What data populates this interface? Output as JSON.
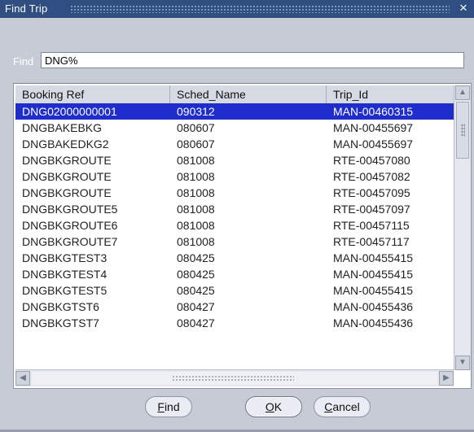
{
  "window": {
    "title": "Find Trip",
    "close_glyph": "×",
    "title_bg": "#2f4f82"
  },
  "search": {
    "label": "Find",
    "value": "DNG%"
  },
  "table": {
    "columns": [
      "Booking Ref",
      "Sched_Name",
      "Trip_Id"
    ],
    "rows": [
      [
        "DNG02000000001",
        "090312",
        "MAN-00460315"
      ],
      [
        "DNGBAKEBKG",
        "080607",
        "MAN-00455697"
      ],
      [
        "DNGBAKEDKG2",
        "080607",
        "MAN-00455697"
      ],
      [
        "DNGBKGROUTE",
        "081008",
        "RTE-00457080"
      ],
      [
        "DNGBKGROUTE",
        "081008",
        "RTE-00457082"
      ],
      [
        "DNGBKGROUTE",
        "081008",
        "RTE-00457095"
      ],
      [
        "DNGBKGROUTE5",
        "081008",
        "RTE-00457097"
      ],
      [
        "DNGBKGROUTE6",
        "081008",
        "RTE-00457115"
      ],
      [
        "DNGBKGROUTE7",
        "081008",
        "RTE-00457117"
      ],
      [
        "DNGBKGTEST3",
        "080425",
        "MAN-00455415"
      ],
      [
        "DNGBKGTEST4",
        "080425",
        "MAN-00455415"
      ],
      [
        "DNGBKGTEST5",
        "080425",
        "MAN-00455415"
      ],
      [
        "DNGBKGTST6",
        "080427",
        "MAN-00455436"
      ],
      [
        "DNGBKGTST7",
        "080427",
        "MAN-00455436"
      ]
    ],
    "selected_index": 0,
    "selected_color": "#1f2dcc"
  },
  "buttons": {
    "find": {
      "accel": "F",
      "rest": "ind"
    },
    "ok": {
      "accel": "O",
      "rest": "K"
    },
    "cancel": {
      "accel": "C",
      "rest": "ancel"
    }
  },
  "icons": {
    "close": "close-icon",
    "scroll_up": "scroll-up-icon",
    "scroll_down": "scroll-down-icon",
    "scroll_left": "scroll-left-icon",
    "scroll_right": "scroll-right-icon"
  }
}
